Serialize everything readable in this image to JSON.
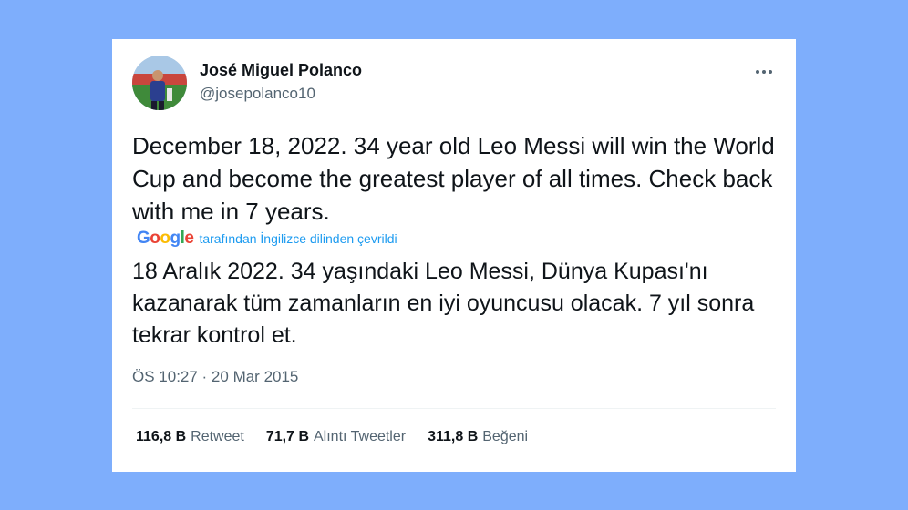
{
  "author": {
    "name": "José Miguel Polanco",
    "handle": "@josepolanco10",
    "avatar_icon": "profile-photo"
  },
  "tweet": {
    "text": "December 18, 2022. 34 year old Leo Messi will win the World Cup and become the greatest player of all times. Check back with me in 7 years.",
    "translation_provider": "Google",
    "translation_note": "tarafından İngilizce dilinden çevrildi",
    "translated_text": "18 Aralık 2022. 34 yaşındaki Leo Messi, Dünya Kupası'nı kazanarak tüm zamanların en iyi oyuncusu olacak. 7 yıl sonra tekrar kontrol et.",
    "timestamp": "ÖS 10:27 · 20 Mar 2015"
  },
  "stats": [
    {
      "value": "116,8 B",
      "label": "Retweet"
    },
    {
      "value": "71,7 B",
      "label": "Alıntı Tweetler"
    },
    {
      "value": "311,8 B",
      "label": "Beğeni"
    }
  ],
  "colors": {
    "background": "#7eaefc",
    "card": "#ffffff",
    "text_primary": "#0f1419",
    "text_secondary": "#536471",
    "link": "#1d9bf0"
  }
}
